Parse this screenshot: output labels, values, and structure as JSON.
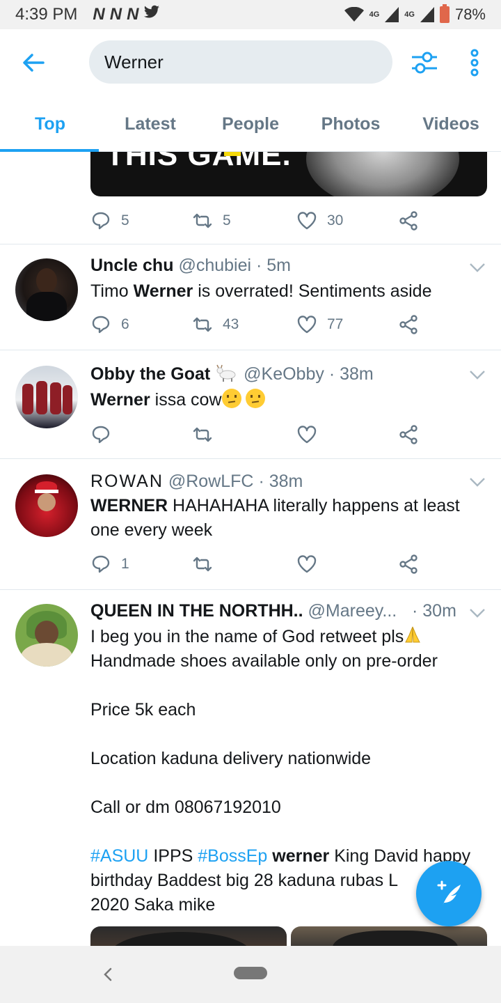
{
  "status_bar": {
    "time": "4:39 PM",
    "notifications": [
      "N",
      "N",
      "N"
    ],
    "network": "4G",
    "network2": "4G",
    "battery": "78%"
  },
  "search": {
    "value": "Werner"
  },
  "tabs": [
    {
      "label": "Top",
      "active": true
    },
    {
      "label": "Latest",
      "active": false
    },
    {
      "label": "People",
      "active": false
    },
    {
      "label": "Photos",
      "active": false
    },
    {
      "label": "Videos",
      "active": false
    }
  ],
  "first_tweet": {
    "media_caption": "THIS GAME.",
    "replies": "5",
    "retweets": "5",
    "likes": "30"
  },
  "tweets": [
    {
      "name": "Uncle chu",
      "handle": "@chubiei",
      "time": "· 5m",
      "text_pre": "Timo ",
      "text_bold": "Werner",
      "text_post": " is overrated! Sentiments aside",
      "replies": "6",
      "retweets": "43",
      "likes": "77"
    },
    {
      "name": "Obby the Goat",
      "handle": "@KeObby",
      "time": "· 38m",
      "text_bold": "Werner",
      "text_post": " issa cow",
      "replies": "",
      "retweets": "",
      "likes": ""
    },
    {
      "name": "ROWAN",
      "handle": "@RowLFC",
      "time": "· 38m",
      "text_bold": "WERNER",
      "text_post": " HAHAHAHA literally happens at least one every week",
      "replies": "1",
      "retweets": "",
      "likes": ""
    },
    {
      "name": "QUEEN IN THE NORTHH..",
      "handle": "@Mareey...",
      "time": "· 30m",
      "line1": "I beg you in the name of God retweet pls",
      "line2": "Handmade shoes available only on pre-order",
      "line3": "Price 5k each",
      "line4": "Location kaduna delivery nationwide",
      "line5": "Call or dm 08067192010",
      "hashtag1": "#ASUU",
      "t1": " IPPS ",
      "hashtag2": "#BossEp",
      "t2_bold": " werner",
      "t3": " King David happy birthday Baddest big 28 kaduna rubas L",
      "t4": "2020 Saka mike"
    }
  ],
  "colors": {
    "accent": "#1da1f2",
    "muted": "#657786",
    "text": "#14171a"
  }
}
